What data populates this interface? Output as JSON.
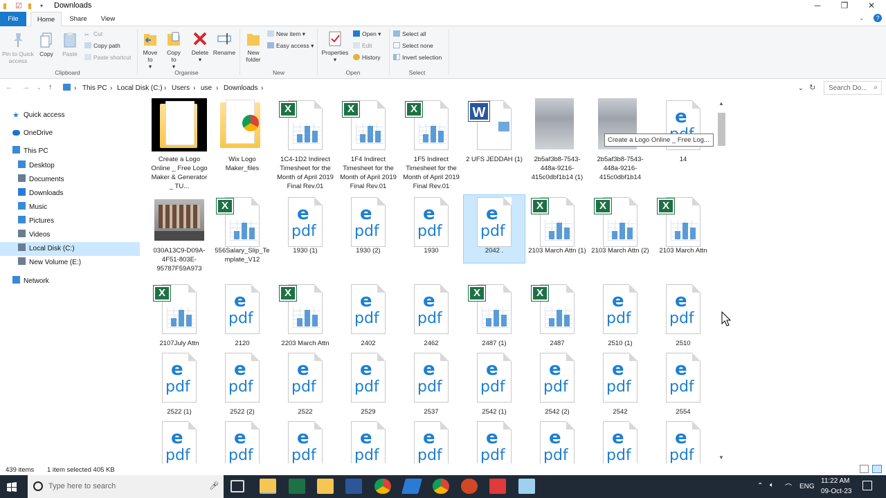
{
  "window": {
    "title": "Downloads",
    "minimize": "─",
    "maximize": "❐",
    "close": "✕"
  },
  "tabs": [
    "File",
    "Home",
    "Share",
    "View"
  ],
  "ribbon": {
    "clipboard": {
      "label": "Clipboard",
      "pin": "Pin to Quick access",
      "copy": "Copy",
      "paste": "Paste",
      "cut": "Cut",
      "copy_path": "Copy path",
      "paste_shortcut": "Paste shortcut"
    },
    "organise": {
      "label": "Organise",
      "move_to": "Move to",
      "copy_to": "Copy to",
      "delete": "Delete",
      "rename": "Rename"
    },
    "new": {
      "label": "New",
      "new_folder": "New folder",
      "new_item": "New item",
      "easy_access": "Easy access"
    },
    "open": {
      "label": "Open",
      "properties": "Properties",
      "open": "Open",
      "edit": "Edit",
      "history": "History"
    },
    "select": {
      "label": "Select",
      "select_all": "Select all",
      "select_none": "Select none",
      "invert": "Invert selection"
    }
  },
  "address": {
    "crumbs": [
      "This PC",
      "Local Disk (C:)",
      "Users",
      "use",
      "Downloads"
    ],
    "search_placeholder": "Search Do..."
  },
  "sidebar": [
    {
      "label": "Quick access",
      "icon": "star-icon",
      "color": "#2b7bd6"
    },
    {
      "label": "OneDrive",
      "icon": "cloud-icon",
      "color": "#1b73c9"
    },
    {
      "label": "This PC",
      "icon": "computer-icon",
      "color": "#3a8ad6"
    },
    {
      "label": "Desktop",
      "icon": "folder-icon",
      "color": "#3a8ad6"
    },
    {
      "label": "Documents",
      "icon": "folder-icon",
      "color": "#6a7d93"
    },
    {
      "label": "Downloads",
      "icon": "folder-icon",
      "color": "#2b7bd6"
    },
    {
      "label": "Music",
      "icon": "folder-icon",
      "color": "#3a8ad6"
    },
    {
      "label": "Pictures",
      "icon": "folder-icon",
      "color": "#3a8ad6"
    },
    {
      "label": "Videos",
      "icon": "folder-icon",
      "color": "#6a7d93"
    },
    {
      "label": "Local Disk (C:)",
      "icon": "drive-icon",
      "color": "#6a7d93"
    },
    {
      "label": "New Volume (E:)",
      "icon": "drive-icon",
      "color": "#6a7d93"
    },
    {
      "label": "Network",
      "icon": "network-icon",
      "color": "#3a8ad6"
    }
  ],
  "files": [
    {
      "name": "Create a Logo Online _ Free Logo Maker & Generator _ TU...",
      "type": "folder-dark"
    },
    {
      "name": "Wix Logo Maker_files",
      "type": "folder"
    },
    {
      "name": "1C4-1D2 Indirect Timesheet for the Month of April 2019 Final Rev.01",
      "type": "excel"
    },
    {
      "name": "1F4 Indirect Timesheet for the Month of April 2019 Final Rev.01",
      "type": "excel"
    },
    {
      "name": "1F5 Indirect Timesheet for the Month of April 2019 Final Rev.01",
      "type": "excel"
    },
    {
      "name": "2 UFS JEDDAH (1)",
      "type": "word"
    },
    {
      "name": "2b5af3b8-7543-448a-9216-415c0dbf1b14 (1)",
      "type": "thumb"
    },
    {
      "name": "2b5af3b8-7543-448a-9216-415c0dbf1b14",
      "type": "thumb"
    },
    {
      "name": "14",
      "type": "pdf"
    },
    {
      "name": "030A13C9-D09A-4F51-803E-95787F59A973",
      "type": "photo"
    },
    {
      "name": "556Salary_Slip_Template_V12",
      "type": "excel"
    },
    {
      "name": "1930 (1)",
      "type": "pdf"
    },
    {
      "name": "1930 (2)",
      "type": "pdf"
    },
    {
      "name": "1930",
      "type": "pdf"
    },
    {
      "name": "2042 .",
      "type": "pdf",
      "selected": true
    },
    {
      "name": "2103 March Attn (1)",
      "type": "excel"
    },
    {
      "name": "2103 March Attn (2)",
      "type": "excel"
    },
    {
      "name": "2103 March Attn",
      "type": "excel"
    },
    {
      "name": "2107July Attn",
      "type": "excel"
    },
    {
      "name": "2120",
      "type": "pdf"
    },
    {
      "name": "2203 March Attn",
      "type": "excel"
    },
    {
      "name": "2402",
      "type": "pdf"
    },
    {
      "name": "2462",
      "type": "pdf"
    },
    {
      "name": "2487 (1)",
      "type": "excel"
    },
    {
      "name": "2487",
      "type": "excel"
    },
    {
      "name": "2510 (1)",
      "type": "pdf"
    },
    {
      "name": "2510",
      "type": "pdf"
    },
    {
      "name": "2522 (1)",
      "type": "pdf"
    },
    {
      "name": "2522 (2)",
      "type": "pdf"
    },
    {
      "name": "2522",
      "type": "pdf"
    },
    {
      "name": "2529",
      "type": "pdf"
    },
    {
      "name": "2537",
      "type": "pdf"
    },
    {
      "name": "2542 (1)",
      "type": "pdf"
    },
    {
      "name": "2542 (2)",
      "type": "pdf"
    },
    {
      "name": "2542",
      "type": "pdf"
    },
    {
      "name": "2554",
      "type": "pdf"
    },
    {
      "name": "",
      "type": "pdf"
    },
    {
      "name": "",
      "type": "pdf"
    },
    {
      "name": "",
      "type": "pdf"
    },
    {
      "name": "",
      "type": "pdf"
    },
    {
      "name": "",
      "type": "pdf"
    },
    {
      "name": "",
      "type": "pdf"
    },
    {
      "name": "",
      "type": "pdf"
    },
    {
      "name": "",
      "type": "pdf"
    },
    {
      "name": "",
      "type": "pdf"
    }
  ],
  "tooltip": "Create a Logo Online _ Free Log...",
  "status": {
    "count": "439 items",
    "selection": "1 item selected  405 KB"
  },
  "taskbar": {
    "search_placeholder": "Type here to search",
    "language": "ENG",
    "time": "11:22 AM",
    "date": "09-Oct-23"
  },
  "colors": {
    "accent": "#1979ca",
    "selection": "#cce8ff",
    "excel": "#1e7145",
    "pdf_edge": "#1d7fd1",
    "taskbar": "#1f2a36"
  }
}
